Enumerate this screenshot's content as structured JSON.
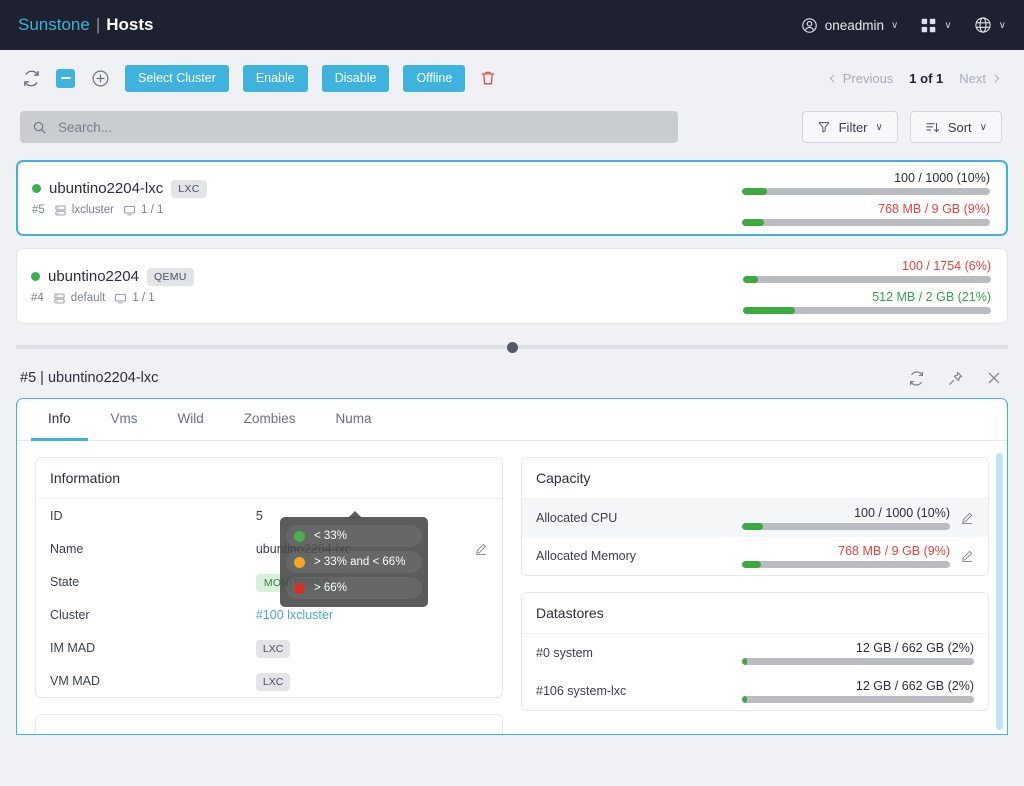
{
  "topnav": {
    "brand_name": "Sunstone",
    "separator": "|",
    "page": "Hosts",
    "user": "oneadmin",
    "user_chevron": "∨",
    "apps_chevron": "∨",
    "lang_chevron": "∨"
  },
  "toolbar": {
    "refresh_icon": "refresh-icon",
    "select_all_checkbox": "indeterminate",
    "add_icon": "plus-circle-icon",
    "select_cluster_label": "Select Cluster",
    "enable_label": "Enable",
    "disable_label": "Disable",
    "offline_label": "Offline",
    "delete_icon": "trash-icon",
    "pager": {
      "previous_label": "Previous",
      "count_label": "1 of 1",
      "next_label": "Next"
    }
  },
  "search": {
    "placeholder": "Search...",
    "value": "",
    "filter_label": "Filter",
    "sort_label": "Sort",
    "filter_chevron": "∨",
    "sort_chevron": "∨"
  },
  "hosts": [
    {
      "selected": true,
      "status": "on",
      "name": "ubuntino2204-lxc",
      "type": "LXC",
      "id": "#5",
      "cluster": "lxcluster",
      "vms": "1 / 1",
      "cpu": {
        "label": "100 / 1000 (10%)",
        "percent": 10,
        "color": "dark"
      },
      "memory": {
        "label": "768 MB / 9 GB (9%)",
        "percent": 9,
        "color": "red"
      }
    },
    {
      "selected": false,
      "status": "on",
      "name": "ubuntino2204",
      "type": "QEMU",
      "id": "#4",
      "cluster": "default",
      "vms": "1 / 1",
      "cpu": {
        "label": "100 / 1754 (6%)",
        "percent": 6,
        "color": "red"
      },
      "memory": {
        "label": "512 MB / 2 GB (21%)",
        "percent": 21,
        "color": "green"
      }
    }
  ],
  "detail": {
    "title": "#5 | ubuntino2204-lxc",
    "refresh_icon": "refresh-icon",
    "pin_icon": "pin-icon",
    "close_icon": "close-icon",
    "tabs": [
      {
        "label": "Info",
        "active": true
      },
      {
        "label": "Vms",
        "active": false
      },
      {
        "label": "Wild",
        "active": false
      },
      {
        "label": "Zombies",
        "active": false
      },
      {
        "label": "Numa",
        "active": false
      }
    ],
    "information": {
      "heading": "Information",
      "rows": [
        {
          "key": "ID",
          "value": "5",
          "kind": "text"
        },
        {
          "key": "Name",
          "value": "ubuntino2204-lxc",
          "kind": "editable"
        },
        {
          "key": "State",
          "value": "MONITORED",
          "kind": "badge-green"
        },
        {
          "key": "Cluster",
          "value": "#100 lxcluster",
          "kind": "link"
        },
        {
          "key": "IM MAD",
          "value": "LXC",
          "kind": "badge"
        },
        {
          "key": "VM MAD",
          "value": "LXC",
          "kind": "badge"
        }
      ]
    },
    "capacity": {
      "heading": "Capacity",
      "rows": [
        {
          "key": "Allocated CPU",
          "label": "100 / 1000 (10%)",
          "percent": 10,
          "color": "dark",
          "editable": true
        },
        {
          "key": "Allocated Memory",
          "label": "768 MB / 9 GB (9%)",
          "percent": 9,
          "color": "red",
          "editable": true
        }
      ]
    },
    "datastores": {
      "heading": "Datastores",
      "rows": [
        {
          "key": "#0 system",
          "label": "12 GB / 662 GB (2%)",
          "percent": 2,
          "color": "dark"
        },
        {
          "key": "#106 system-lxc",
          "label": "12 GB / 662 GB (2%)",
          "percent": 2,
          "color": "dark"
        }
      ]
    },
    "tooltip": {
      "rows": [
        {
          "color": "#4caf50",
          "label": "< 33%"
        },
        {
          "color": "#f5a623",
          "label": "> 33% and < 66%"
        },
        {
          "color": "#d93025",
          "label": "> 66%"
        }
      ]
    }
  },
  "colors": {
    "brand": "#3fb3dd",
    "nav_bg": "#1e2230",
    "green": "#3bab3f",
    "red": "#e8413c",
    "page_bg": "#eff1f5"
  }
}
